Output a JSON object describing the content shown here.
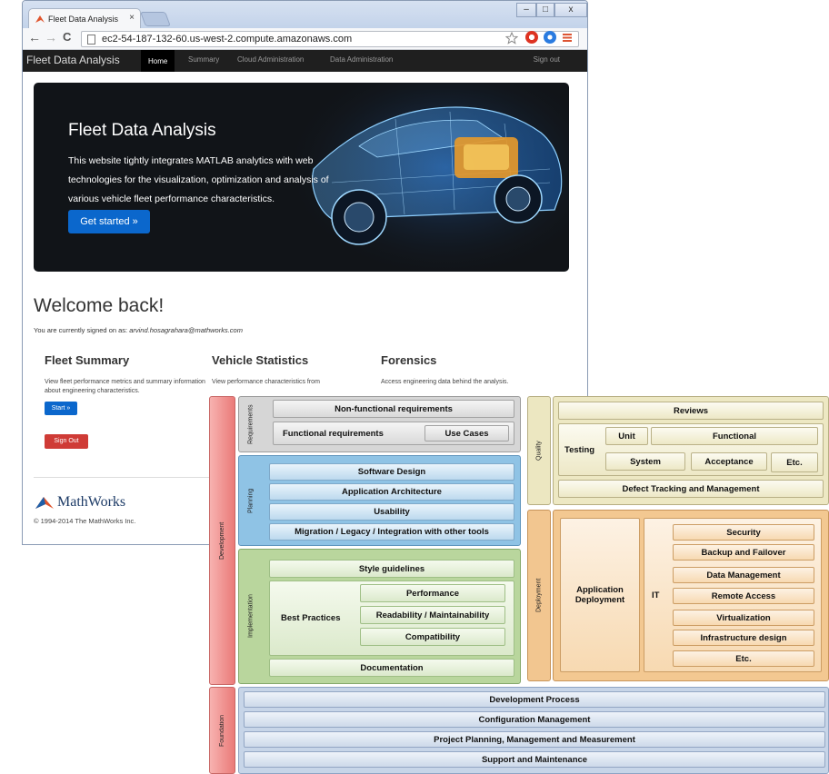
{
  "browser": {
    "tab_title": "Fleet Data Analysis",
    "tab_close": "×",
    "url": "ec2-54-187-132-60.us-west-2.compute.amazonaws.com",
    "window_controls": [
      "–",
      "□",
      "x"
    ],
    "nav": {
      "back": "←",
      "forward": "→",
      "reload": "C"
    }
  },
  "navbar": {
    "brand": "Fleet Data Analysis",
    "links": [
      "Home",
      "Summary",
      "Cloud Administration",
      "Data Administration"
    ],
    "signout": "Sign out"
  },
  "hero": {
    "title": "Fleet Data Analysis",
    "text": "This website tightly integrates MATLAB analytics with web technologies for the visualization, optimization and analysis of various vehicle fleet performance characteristics.",
    "button": "Get started »"
  },
  "welcome": {
    "title": "Welcome back!",
    "signed_prefix": "You are currently signed on as: ",
    "user": "arvind.hosagrahara@mathworks.com"
  },
  "columns": [
    {
      "title": "Fleet Summary",
      "text": "View fleet performance metrics and summary information about engineering characteristics."
    },
    {
      "title": "Vehicle Statistics",
      "text": "View performance characteristics from"
    },
    {
      "title": "Forensics",
      "text": "Access engineering data behind the analysis."
    }
  ],
  "buttons": {
    "start": "Start »",
    "signout": "Sign Out"
  },
  "footer": {
    "logo": "MathWorks",
    "copyright": "© 1994-2014 The MathWorks Inc."
  },
  "diagram": {
    "labels": {
      "development": "Development",
      "foundation": "Foundation",
      "requirements": "Requirements",
      "planning": "Planning",
      "implementation": "Implementation",
      "quality": "Quality",
      "deployment": "Deployment"
    },
    "requirements": {
      "nonfunctional": "Non-functional requirements",
      "functional": "Functional requirements",
      "usecases": "Use Cases"
    },
    "planning": [
      "Software Design",
      "Application Architecture",
      "Usability",
      "Migration / Legacy / Integration with other tools"
    ],
    "implementation": {
      "style": "Style guidelines",
      "best_practices": "Best Practices",
      "practices": [
        "Performance",
        "Readability / Maintainability",
        "Compatibility"
      ],
      "documentation": "Documentation"
    },
    "quality": {
      "reviews": "Reviews",
      "testing": "Testing",
      "unit": "Unit",
      "functional": "Functional",
      "system": "System",
      "acceptance": "Acceptance",
      "etc": "Etc.",
      "defect": "Defect Tracking and Management"
    },
    "deployment": {
      "app": "Application Deployment",
      "it": "IT",
      "items": [
        "Security",
        "Backup and Failover",
        "Data Management",
        "Remote Access",
        "Virtualization",
        "Infrastructure design",
        "Etc."
      ]
    },
    "foundation": [
      "Development Process",
      "Configuration Management",
      "Project Planning, Management and Measurement",
      "Support and Maintenance"
    ]
  },
  "colors": {
    "primary_button": "#0b67cc",
    "danger_button": "#cf3b36",
    "dev_band": "#ee8a88",
    "req_band": "#d2d2d2",
    "plan_band": "#8ec2e4",
    "impl_band": "#b7d49b",
    "quality_band": "#ece7c0",
    "deploy_band": "#f1c58e"
  }
}
